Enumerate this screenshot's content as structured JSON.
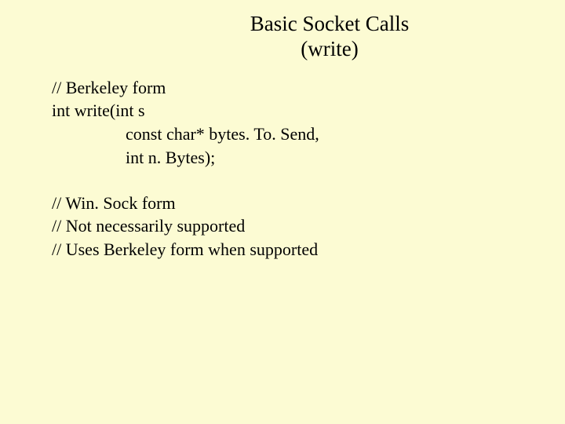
{
  "title": {
    "line1": "Basic Socket Calls",
    "line2": "(write)"
  },
  "body": {
    "line1": "// Berkeley form",
    "line2": "int write(int s",
    "line3": "const char* bytes. To. Send,",
    "line4": "int n. Bytes);",
    "line5": "// Win. Sock form",
    "line6": "// Not necessarily supported",
    "line7": "// Uses Berkeley form when supported"
  }
}
